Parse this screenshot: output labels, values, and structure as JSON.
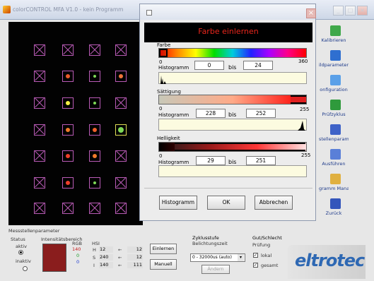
{
  "window": {
    "title": "colorCONTROL MFA V1.0 - kein Programm"
  },
  "toolbar": [
    {
      "label": "Kalibrieren",
      "color": "#3fa84a"
    },
    {
      "label": "ildparameter",
      "color": "#2f6fd0"
    },
    {
      "label": "onfiguration",
      "color": "#5aa0e8"
    },
    {
      "label": "Prüfzyklus",
      "color": "#2f9a3c"
    },
    {
      "label": "stellenparameter",
      "color": "#3e62c8"
    },
    {
      "label": "Ausführen",
      "color": "#5a7fd8"
    },
    {
      "label": "gramm Manager",
      "color": "#e0b040"
    },
    {
      "label": "Zurück",
      "color": "#3355bb"
    }
  ],
  "dialog": {
    "header": "Farbe einlernen",
    "farbe": {
      "label": "Farbe",
      "scale_min": "0",
      "scale_max": "360",
      "hist_label": "Histogramm",
      "from": "0",
      "bis": "bis",
      "to": "24"
    },
    "saettigung": {
      "label": "Sättigung",
      "scale_min": "0",
      "scale_max": "255",
      "hist_label": "Histogramm",
      "from": "228",
      "bis": "bis",
      "to": "252"
    },
    "helligkeit": {
      "label": "Helligkeit",
      "scale_min": "0",
      "scale_max": "255",
      "hist_label": "Histogramm",
      "from": "29",
      "bis": "bis",
      "to": "251"
    },
    "btn_histogramm": "Histogramm",
    "btn_ok": "OK",
    "btn_abbrechen": "Abbrechen"
  },
  "bottom": {
    "title": "Messstellenparameter",
    "status": {
      "title": "Status",
      "aktiv": "aktiv",
      "inaktiv": "inaktiv"
    },
    "intensity": {
      "title": "Intensitätsbereich",
      "rgb_title": "RGB",
      "r": "140",
      "g": "0",
      "b": "0",
      "swatch": "#8a1d1d"
    },
    "hsi": {
      "title": "HSI",
      "h_label": "H",
      "h_val": "12",
      "h_val2": "12",
      "s_label": "S",
      "s_val": "240",
      "s_val2": "12",
      "i_label": "I",
      "i_val": "140",
      "i_val2": "111"
    },
    "btn_einlernen": "Einlernen",
    "btn_manuell": "Manuell",
    "zyklus": {
      "title": "Zyklusstufe",
      "sub": "Belichtungszeit",
      "select": "0 - 32000us (auto)",
      "btn": "Ändern"
    },
    "gut": {
      "title": "Gut/Schlecht",
      "sub": "Prüfung",
      "lokal": "lokal",
      "gesamt": "gesamt"
    },
    "logo": "eltrotec"
  }
}
